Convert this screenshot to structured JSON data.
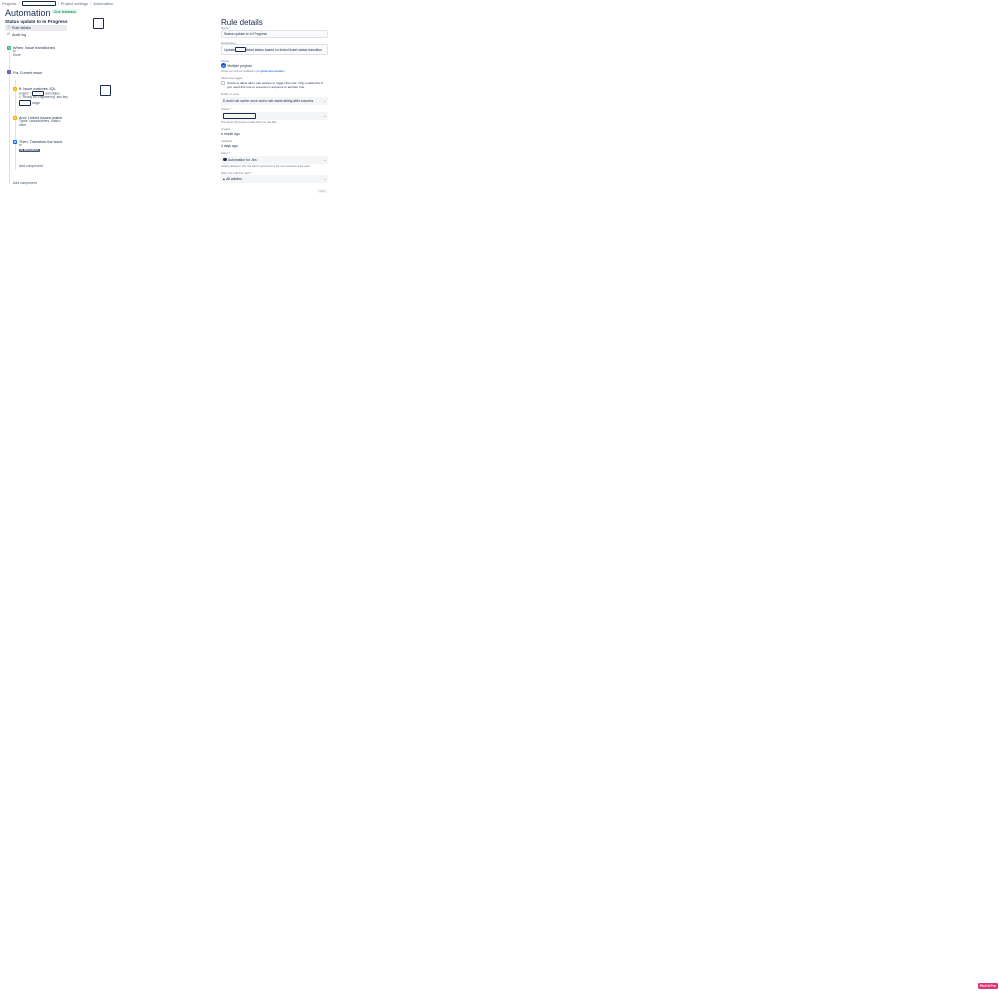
{
  "breadcrumbs": {
    "projects": "Projects",
    "project_settings": "Project settings",
    "automation": "Automation",
    "separator": "/"
  },
  "header": {
    "title": "Automation",
    "feedback": "Give feedback"
  },
  "rule": {
    "name": "Status update to In Progress"
  },
  "sidebar": {
    "items": [
      {
        "label": "Rule details",
        "icon": "info-icon"
      },
      {
        "label": "Audit log",
        "icon": "history-icon"
      }
    ]
  },
  "flow": {
    "trigger": {
      "title": "When: Issue transitioned",
      "line1": "to",
      "line2": "Done"
    },
    "branch": {
      "title": "For Current issue"
    },
    "condition": {
      "title": "If: Issue matches JQL",
      "line1a": "project = ",
      "line1b": " and status",
      "line2": "= \"Ready for Engineering\" and key",
      "line3b": " range"
    },
    "linked": {
      "title": "And: Linked issues match",
      "line1": "Types: causes/defers. Status:",
      "line2": "done"
    },
    "action": {
      "title": "Then: Transition the issue",
      "line1": "to",
      "status": "IN PROGRESS"
    },
    "add_component_inner": "Add component",
    "add_component_outer": "Add component"
  },
  "details": {
    "title": "Rule details",
    "name_label": "Name *",
    "name_value": "Status update to In Progress",
    "desc_label": "Description",
    "desc_prefix": "Update",
    "desc_suffix": "ticket status based on linked ticket status transition",
    "scope_label": "Scope",
    "scope_value": "Multiple projects",
    "scope_help_prefix": "Scope can only be modified in the ",
    "scope_help_link": "global administration",
    "allow_label": "Allow rule trigger",
    "allow_text1": "Check to allow other rule actions to trigger this rule. Only enable this if",
    "allow_text2": "you need this rule to execute in response to another rule.",
    "notify_label": "Notify on error",
    "notify_value": "E-mail rule owner once when rule starts failing after success",
    "owner_label": "Owner *",
    "owner_help": "The owner will receive emails when the rule fails.",
    "creator_label": "Creator",
    "creator_value": "a month ago",
    "updated_label": "Updated",
    "updated_value": "4 days ago",
    "actor_label": "Actor *",
    "actor_value": "Automation for Jira",
    "actor_help": "Actions defined in this rule will be performed by the user selected as the actor.",
    "edit_label": "Who can edit this rule? *",
    "edit_value": "All admins",
    "save_label": "Save"
  },
  "badge": "Pixlr'd Pro",
  "colors": {
    "trigger": "#36b37e",
    "branch": "#6554c0",
    "condition": "#ffab00",
    "action": "#0065ff",
    "link": "#0052cc"
  }
}
